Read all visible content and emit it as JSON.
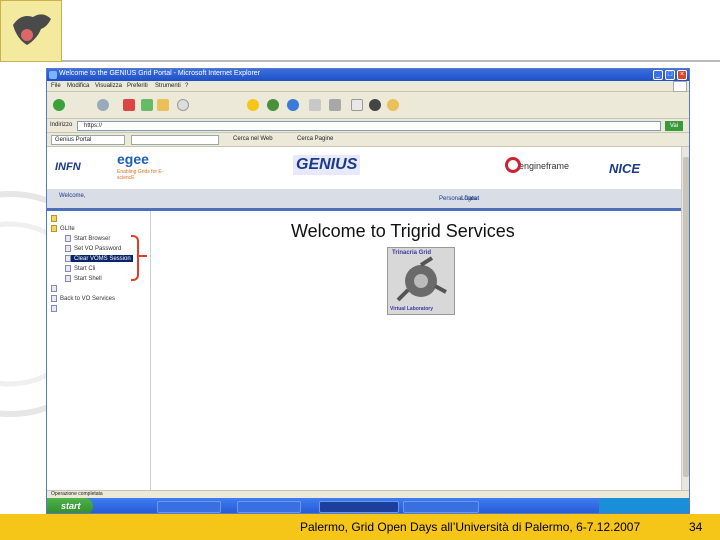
{
  "slide": {
    "footer_text": "Palermo, Grid Open Days all’Università di Palermo, 6-7.12.2007",
    "page_number": "34",
    "colors": {
      "footer": "#f5c518",
      "logo_bg": "#f3eaa0"
    }
  },
  "browser": {
    "title": "Welcome to the GENIUS Grid Portal - Microsoft Internet Explorer",
    "menu": [
      "File",
      "Modifica",
      "Visualizza",
      "Preferiti",
      "Strumenti",
      "?"
    ],
    "address_label": "Indirizzo",
    "address_value": "https://",
    "go_label": "Vai",
    "links_field": "Genius Portal",
    "links_buttons": [
      "Cerca nel Web",
      "Cerca Pagine"
    ],
    "status_text": "Operazione completata"
  },
  "portal": {
    "logos": [
      "INFN",
      "egee",
      "GENIUS",
      "engineframe",
      "NICE"
    ],
    "egee_tagline": "Enabling Grids for E-sciencE",
    "nav_welcome": "Welcome, ",
    "nav_links": [
      "Personal Data",
      "Logout"
    ],
    "tree": [
      {
        "label": "",
        "type": "root"
      },
      {
        "label": "GLIte",
        "type": "folder"
      },
      {
        "label": "Start Browser",
        "type": "page"
      },
      {
        "label": "Set VO Password",
        "type": "page"
      },
      {
        "label": "Clear VOMS Session",
        "type": "page",
        "selected": true
      },
      {
        "label": "Start Cli",
        "type": "page"
      },
      {
        "label": "Start Shell",
        "type": "page"
      },
      {
        "label": "",
        "type": "page"
      },
      {
        "label": "Back to VO Services",
        "type": "page"
      },
      {
        "label": "",
        "type": "page"
      }
    ],
    "welcome_title": "Welcome to Trigrid Services",
    "trigrid_logo_text": [
      "Trinacria Grid",
      "Virtual Laboratory"
    ],
    "copyright": ""
  },
  "taskbar": {
    "start_label": "start",
    "tasks": [
      "",
      "",
      "",
      ""
    ],
    "clock": ""
  }
}
